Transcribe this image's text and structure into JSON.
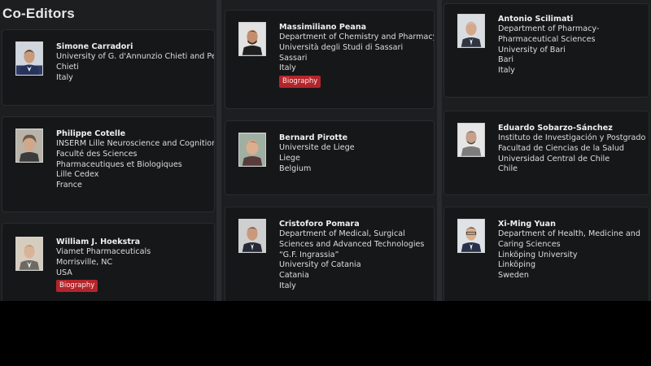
{
  "section_title": "Co-Editors",
  "editors": [
    {
      "name": "Simone Carradori",
      "lines": [
        "University of G. d'Annunzio Chieti and Pescara",
        "Chieti",
        "Italy"
      ],
      "biography": null
    },
    {
      "name": "Philippe Cotelle",
      "lines": [
        "INSERM Lille Neuroscience and Cognition",
        "Faculté des Sciences Pharmaceutiques et Biologiques",
        "Lille Cedex",
        "France"
      ],
      "biography": null
    },
    {
      "name": "William J. Hoekstra",
      "lines": [
        "Viamet Pharmaceuticals",
        "Morrisville, NC",
        "USA"
      ],
      "biography": "Biography"
    },
    {
      "name": "Massimiliano Peana",
      "lines": [
        "Department of Chemistry and Pharmacy",
        "Università degli Studi di Sassari",
        "Sassari",
        "Italy"
      ],
      "biography": "Biography"
    },
    {
      "name": "Bernard Pirotte",
      "lines": [
        "Universite de Liege",
        "Liege",
        "Belgium"
      ],
      "biography": null
    },
    {
      "name": "Cristoforo Pomara",
      "lines": [
        "Department of Medical, Surgical Sciences and Advanced Technologies “G.F. Ingrassia”",
        "University of Catania",
        "Catania",
        "Italy"
      ],
      "biography": null
    },
    {
      "name": "Antonio Scilimati",
      "lines": [
        "Department of Pharmacy-Pharmaceutical Sciences",
        "University of Bari",
        "Bari",
        "Italy"
      ],
      "biography": null
    },
    {
      "name": "Eduardo Sobarzo-Sánchez",
      "lines": [
        "Instituto de Investigación y Postgrado",
        "Facultad de Ciencias de la Salud",
        "Universidad Central de Chile",
        "Chile"
      ],
      "biography": null
    },
    {
      "name": "Xi-Ming Yuan",
      "lines": [
        "Department of Health, Medicine and Caring Sciences",
        "Linköping University",
        "Linköping",
        "Sweden"
      ],
      "biography": null
    }
  ],
  "colors": {
    "page_bg": "#1d1e20",
    "card_bg": "#161719",
    "button": "#b3252b",
    "letterbox": "#000000"
  },
  "icons": [
    "portrait-photo"
  ]
}
